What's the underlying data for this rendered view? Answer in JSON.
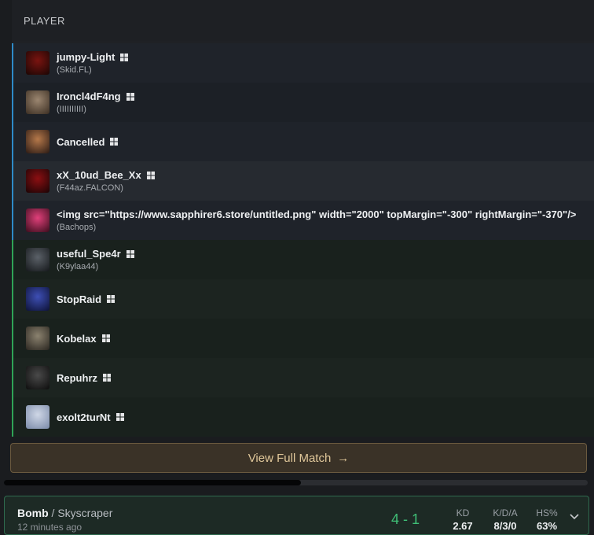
{
  "table": {
    "header": "PLAYER",
    "players": [
      {
        "name": "jumpy-Light",
        "sub": "(Skid.FL)",
        "team": "a",
        "avatar_colors": [
          "#7a1410",
          "#1a0604"
        ]
      },
      {
        "name": "Ironcl4dF4ng",
        "sub": "(IIIIIIIIII)",
        "team": "a",
        "avatar_colors": [
          "#9b8670",
          "#3b2e22"
        ]
      },
      {
        "name": "Cancelled",
        "sub": "",
        "team": "a",
        "avatar_colors": [
          "#b5784a",
          "#2a1a14"
        ]
      },
      {
        "name": "xX_10ud_Bee_Xx",
        "sub": "(F44az.FALCON)",
        "team": "a",
        "avatar_colors": [
          "#8c0f12",
          "#1a0405"
        ]
      },
      {
        "name": "<img src=\"https://www.sapphirer6.store/untitled.png\" width=\"2000\" topMargin=\"-300\" rightMargin=\"-370\"/>",
        "sub": "(Bachops)",
        "team": "a",
        "avatar_colors": [
          "#e0407a",
          "#3a0c1c"
        ]
      },
      {
        "name": "useful_Spe4r",
        "sub": "(K9ylaa44)",
        "team": "b",
        "avatar_colors": [
          "#5b6168",
          "#15181b"
        ]
      },
      {
        "name": "StopRaid",
        "sub": "",
        "team": "b",
        "avatar_colors": [
          "#3e4fb5",
          "#0d1236"
        ]
      },
      {
        "name": "Kobelax",
        "sub": "",
        "team": "b",
        "avatar_colors": [
          "#8b826f",
          "#2a2620"
        ]
      },
      {
        "name": "Repuhrz",
        "sub": "",
        "team": "b",
        "avatar_colors": [
          "#4a4a4a",
          "#0d0d0d"
        ]
      },
      {
        "name": "exolt2turNt",
        "sub": "",
        "team": "b",
        "avatar_colors": [
          "#cfd7e6",
          "#7a8aa8"
        ]
      }
    ]
  },
  "view_full_match": {
    "label": "View Full Match",
    "icon": "arrow-right-icon"
  },
  "match": {
    "mode": "Bomb",
    "separator": " / ",
    "map": "Skyscraper",
    "time": "12 minutes ago",
    "score": "4 - 1",
    "stats": [
      {
        "label": "KD",
        "value": "2.67"
      },
      {
        "label": "K/D/A",
        "value": "8/3/0"
      },
      {
        "label": "HS%",
        "value": "63%"
      }
    ]
  },
  "colors": {
    "team_a": "#2e8ac7",
    "team_b": "#2fa356",
    "win": "#3fbf76",
    "button_text": "#e0c79a"
  },
  "platform_icon": "windows-icon"
}
